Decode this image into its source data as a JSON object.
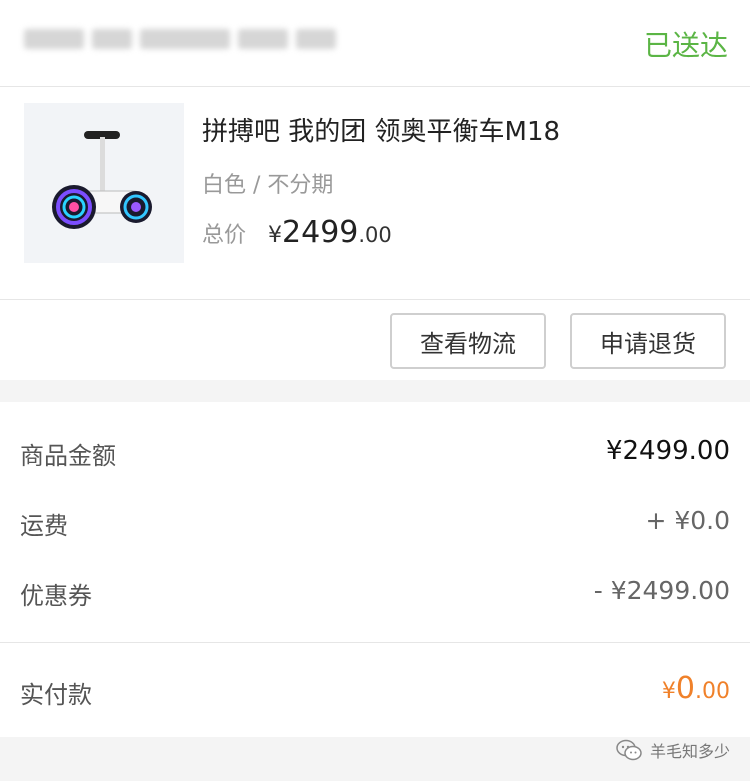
{
  "header": {
    "order_no_redacted": "",
    "status": "已送达",
    "status_color": "#5bb545"
  },
  "product": {
    "image_icon": "self-balancing-scooter-image",
    "title": "拼搏吧 我的团 领奥平衡车M18",
    "variant": "白色 / 不分期",
    "price_label": "总价",
    "price_symbol": "¥",
    "price_integer": "2499",
    "price_decimal": ".00"
  },
  "actions": {
    "logistics": "查看物流",
    "return": "申请退货"
  },
  "summary": {
    "goods_label": "商品金额",
    "goods_value": "¥2499.00",
    "shipping_label": "运费",
    "shipping_value": "+ ¥0.0",
    "coupon_label": "优惠券",
    "coupon_value": "- ¥2499.00"
  },
  "paid": {
    "label": "实付款",
    "symbol": "¥",
    "integer": "0",
    "decimal": ".00",
    "color": "#f0812a"
  },
  "watermark": {
    "icon": "wechat-icon",
    "text": "羊毛知多少"
  }
}
